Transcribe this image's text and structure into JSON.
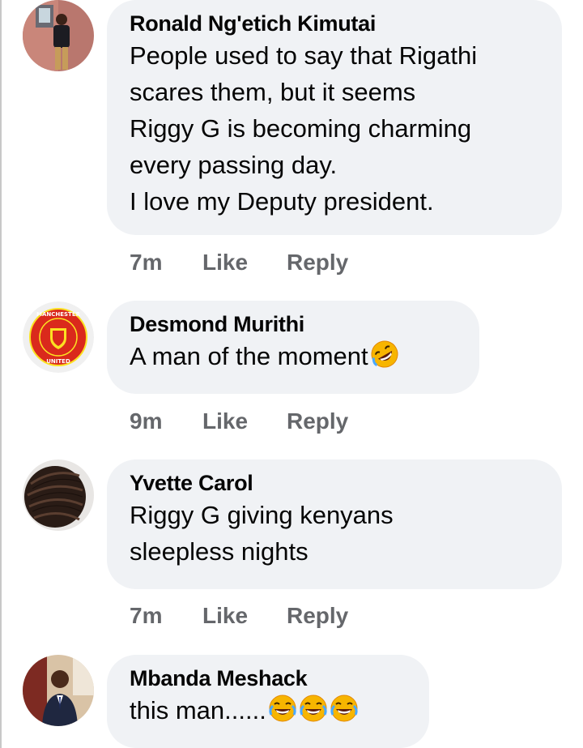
{
  "comments": [
    {
      "name": "Ronald Ng'etich Kimutai",
      "lines": [
        "People used to say that Rigathi",
        "scares them, but it seems",
        "Riggy G is becoming charming",
        "every passing day.",
        "I love my Deputy president."
      ],
      "time": "7m",
      "like": "Like",
      "reply": "Reply",
      "avatar": "person-photo-avatar"
    },
    {
      "name": "Desmond Murithi",
      "lines": [
        "A man of the moment"
      ],
      "emoji": [
        "rolling-on-floor-laughing-emoji"
      ],
      "time": "9m",
      "like": "Like",
      "reply": "Reply",
      "avatar": "manchester-united-crest-avatar",
      "crest_text": [
        "MANCHESTER",
        "UNITED"
      ]
    },
    {
      "name": "Yvette Carol",
      "lines": [
        "Riggy G giving kenyans",
        "sleepless nights"
      ],
      "time": "7m",
      "like": "Like",
      "reply": "Reply",
      "avatar": "braided-hair-avatar"
    },
    {
      "name": "Mbanda Meshack",
      "lines": [
        "this man......"
      ],
      "emoji": [
        "tears-of-joy-emoji",
        "tears-of-joy-emoji",
        "tears-of-joy-emoji"
      ],
      "avatar": "man-in-suit-avatar"
    }
  ],
  "colors": {
    "bubble": "#f0f2f5",
    "meta": "#65676b",
    "text": "#050505",
    "crest_red": "#da291c",
    "crest_gold": "#fbe122"
  }
}
